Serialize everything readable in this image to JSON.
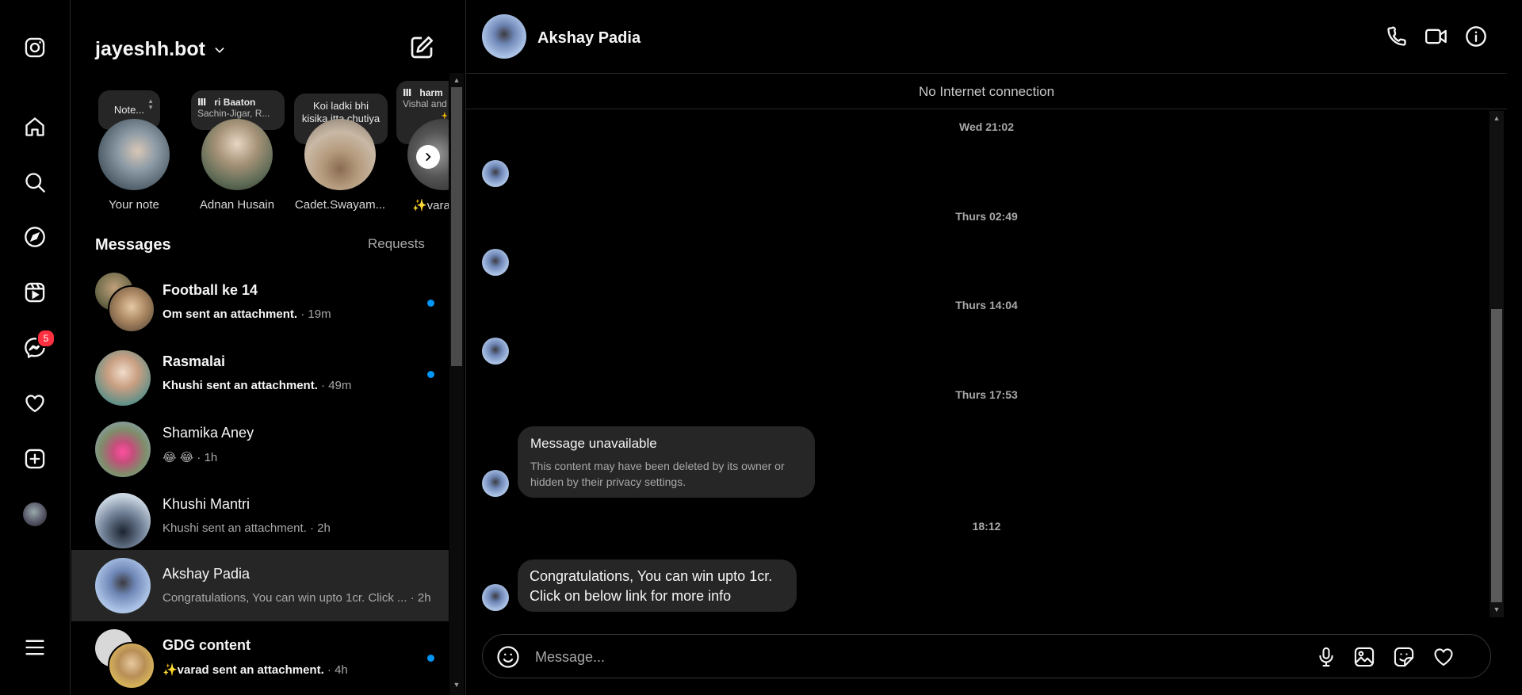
{
  "colors": {
    "background": "#000000",
    "accent_blue": "#0095f6",
    "badge_red": "#ff3040",
    "bubble": "#262626"
  },
  "rail": {
    "items": [
      "instagram-logo-icon",
      "home-icon",
      "search-icon",
      "explore-icon",
      "reels-icon",
      "messenger-icon",
      "heart-icon",
      "create-icon",
      "profile-avatar",
      "menu-icon"
    ],
    "messenger_badge": "5"
  },
  "list": {
    "username": "jayeshh.bot",
    "notes": [
      {
        "label": "Your note",
        "bubble": "Note..."
      },
      {
        "label": "Adnan Husain",
        "bubble_title": "ri Baaton",
        "bubble_sub": "Sachin-Jigar, R..."
      },
      {
        "label": "Cadet.Swayam...",
        "bubble": "Koi ladki bhi kisika itta chutiya na kat..."
      },
      {
        "label": "✨varad",
        "bubble_title": "harm",
        "bubble_sub": "Vishal and",
        "bubble_emoji": "✨"
      }
    ],
    "messages_heading": "Messages",
    "requests_label": "Requests",
    "conversations": [
      {
        "name": "Football ke 14",
        "preview": "Om sent an attachment.",
        "time": "· 19m",
        "unread": true
      },
      {
        "name": "Rasmalai",
        "preview": "Khushi sent an attachment.",
        "time": "· 49m",
        "unread": true
      },
      {
        "name": "Shamika Aney",
        "preview": "😂 😂",
        "time": "· 1h",
        "unread": false
      },
      {
        "name": "Khushi Mantri",
        "preview": "Khushi sent an attachment.",
        "time": "· 2h",
        "unread": false
      },
      {
        "name": "Akshay Padia",
        "preview": "Congratulations, You can win upto 1cr. Click ...",
        "time": "· 2h",
        "unread": false,
        "active": true
      },
      {
        "name": "GDG content",
        "preview": "✨varad sent an attachment.",
        "time": "· 4h",
        "unread": true
      }
    ]
  },
  "chat": {
    "name": "Akshay Padia",
    "connection_status": "No Internet connection",
    "timestamps": [
      "Wed 21:02",
      "Thurs 02:49",
      "Thurs 14:04",
      "Thurs 17:53",
      "18:12"
    ],
    "unavailable": {
      "title": "Message unavailable",
      "body": "This content may have been deleted by its owner or hidden by their privacy settings."
    },
    "last_message_line1": "Congratulations, You can win upto 1cr.",
    "last_message_line2": "Click on below link for more info",
    "composer_placeholder": "Message..."
  }
}
